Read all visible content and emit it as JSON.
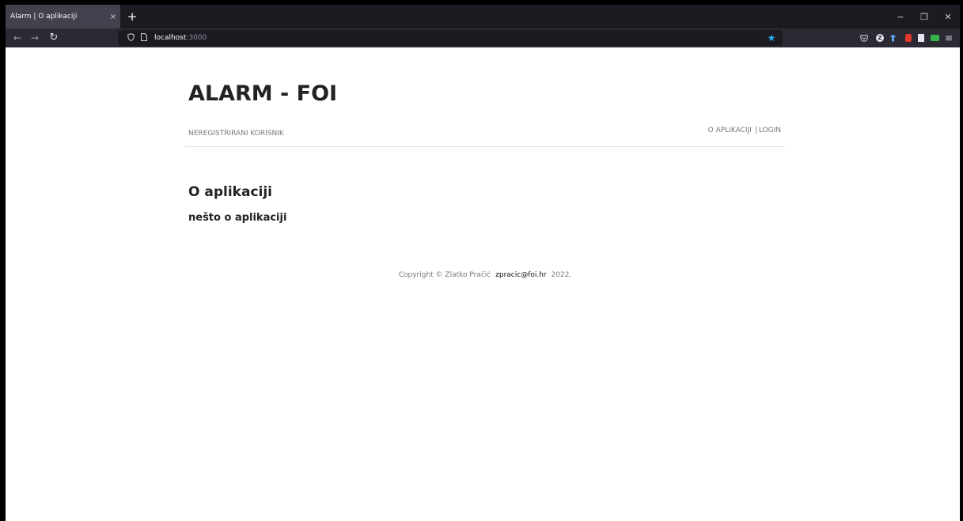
{
  "browser": {
    "tab": {
      "title": "Alarm | O aplikaciji",
      "close_glyph": "×"
    },
    "new_tab_glyph": "+",
    "window_controls": {
      "minimize": "−",
      "restore": "❐",
      "close": "✕"
    },
    "nav": {
      "back": "←",
      "forward": "→",
      "reload": "↻"
    },
    "url": {
      "host": "localhost",
      "port": ":3000"
    },
    "icons": [
      "shield-icon",
      "page-icon",
      "bookmark-star-icon",
      "pocket-icon",
      "extension-z-icon",
      "extension-blue-icon",
      "extension-red-icon",
      "reader-icon",
      "extension-green-icon",
      "hamburger-menu-icon"
    ],
    "colors": {
      "tabstrip": "#1c1b22",
      "toolbar": "#2b2a33",
      "star": "#2fb2f3"
    }
  },
  "site": {
    "title": "ALARM - FOI",
    "user_role": "NEREGISTRIRANI KORISNIK",
    "menu": {
      "about": "O APLIKACIJI",
      "separator": "|",
      "login": "LOGIN"
    }
  },
  "main": {
    "heading": "O aplikaciji",
    "text": "nešto o aplikaciji"
  },
  "footer": {
    "copyright": "Copyright © Zlatko Pračić",
    "email": "zpracic@foi.hr",
    "year": "2022."
  }
}
